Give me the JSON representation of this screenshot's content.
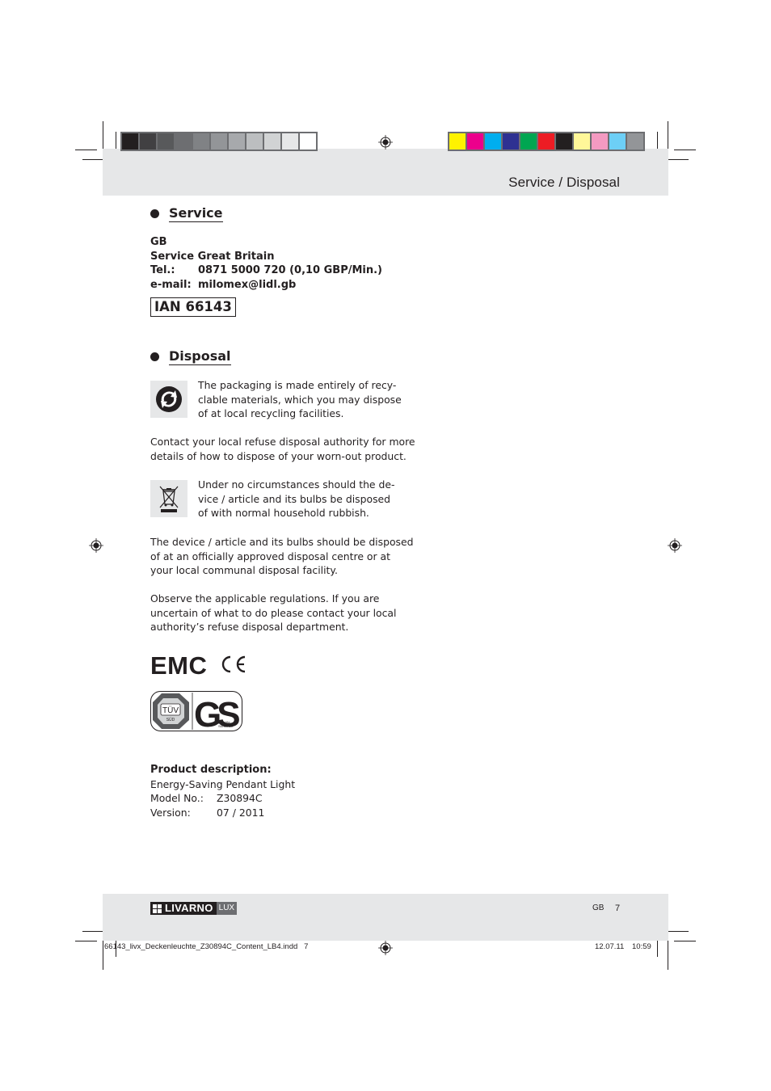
{
  "print_marks": {
    "gray_swatches": [
      "#231f20",
      "#414042",
      "#58595b",
      "#6d6e71",
      "#808285",
      "#939598",
      "#a7a9ac",
      "#bcbec0",
      "#d1d3d4",
      "#e6e7e8",
      "#ffffff"
    ],
    "color_swatches": [
      "#fff200",
      "#ec008c",
      "#00aeef",
      "#2e3192",
      "#00a651",
      "#ed1c24",
      "#231f20",
      "#fff799",
      "#f49ac1",
      "#6dcff6",
      "#939598"
    ]
  },
  "header": {
    "title": "Service / Disposal"
  },
  "service": {
    "heading": "Service",
    "country": "GB",
    "name": "Service Great Britain",
    "tel_label": "Tel.:",
    "tel_value": "0871 5000 720 (0,10 GBP/Min.)",
    "email_label": "e-mail:",
    "email_value": "milomex@lidl.gb",
    "ian": "IAN 66143"
  },
  "disposal": {
    "heading": "Disposal",
    "recycle_text": [
      "The packaging is made entirely of recy-",
      "clable materials, which you may dispose",
      "of at local recycling facilities."
    ],
    "contact_text": [
      "Contact your local refuse disposal authority for more",
      "details of how to dispose of your worn-out product."
    ],
    "weee_text": [
      "Under no circumstances should the de-",
      "vice / article and its bulbs be disposed",
      "of with normal household rubbish."
    ],
    "centre_text": [
      "The device / article and its bulbs should be disposed",
      "of at an officially approved disposal centre or at",
      "your local communal disposal facility."
    ],
    "regulations_text": [
      "Observe the applicable regulations. If you are",
      "uncertain of what to do please contact your local",
      "authority’s refuse disposal department."
    ]
  },
  "marks": {
    "emc": "EMC",
    "ce": "CE",
    "tuv": "TÜV",
    "tuv_sub": "SÜD",
    "gs": "GS",
    "gs_sub1": "geprüfte",
    "gs_sub2": "Sicherheit"
  },
  "product": {
    "heading": "Product description:",
    "name": "Energy-Saving Pendant Light",
    "model_label": "Model No.:",
    "model_value": "Z30894C",
    "version_label": "Version:",
    "version_value": "07 / 2011"
  },
  "footer": {
    "brand": "LIVARNO",
    "brand_sub": "LUX",
    "lang": "GB",
    "page": "7",
    "file_info": "66143_livx_Deckenleuchte_Z30894C_Content_LB4.indd   7",
    "date": "12.07.11",
    "time": "10:59"
  }
}
